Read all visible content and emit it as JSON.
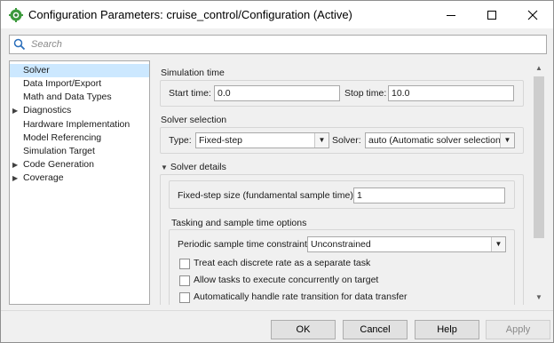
{
  "window": {
    "title": "Configuration Parameters: cruise_control/Configuration (Active)"
  },
  "search": {
    "placeholder": "Search"
  },
  "tree": {
    "items": [
      {
        "label": "Solver",
        "selected": true,
        "expandable": false
      },
      {
        "label": "Data Import/Export",
        "expandable": false
      },
      {
        "label": "Math and Data Types",
        "expandable": false
      },
      {
        "label": "Diagnostics",
        "expandable": true
      },
      {
        "label": "Hardware Implementation",
        "expandable": false
      },
      {
        "label": "Model Referencing",
        "expandable": false
      },
      {
        "label": "Simulation Target",
        "expandable": false
      },
      {
        "label": "Code Generation",
        "expandable": true
      },
      {
        "label": "Coverage",
        "expandable": true
      }
    ]
  },
  "simulation_time": {
    "title": "Simulation time",
    "start_label": "Start time:",
    "start_value": "0.0",
    "stop_label": "Stop time:",
    "stop_value": "10.0"
  },
  "solver_selection": {
    "title": "Solver selection",
    "type_label": "Type:",
    "type_value": "Fixed-step",
    "solver_label": "Solver:",
    "solver_value": "auto (Automatic solver selection)"
  },
  "solver_details": {
    "title": "Solver details",
    "step_size_label": "Fixed-step size (fundamental sample time):",
    "step_size_value": "1",
    "tasking_title": "Tasking and sample time options",
    "periodic_label": "Periodic sample time constraint:",
    "periodic_value": "Unconstrained",
    "checkboxes": [
      {
        "label": "Treat each discrete rate as a separate task",
        "checked": false
      },
      {
        "label": "Allow tasks to execute concurrently on target",
        "checked": false
      },
      {
        "label": "Automatically handle rate transition for data transfer",
        "checked": false
      }
    ]
  },
  "buttons": {
    "ok": "OK",
    "cancel": "Cancel",
    "help": "Help",
    "apply": "Apply"
  }
}
